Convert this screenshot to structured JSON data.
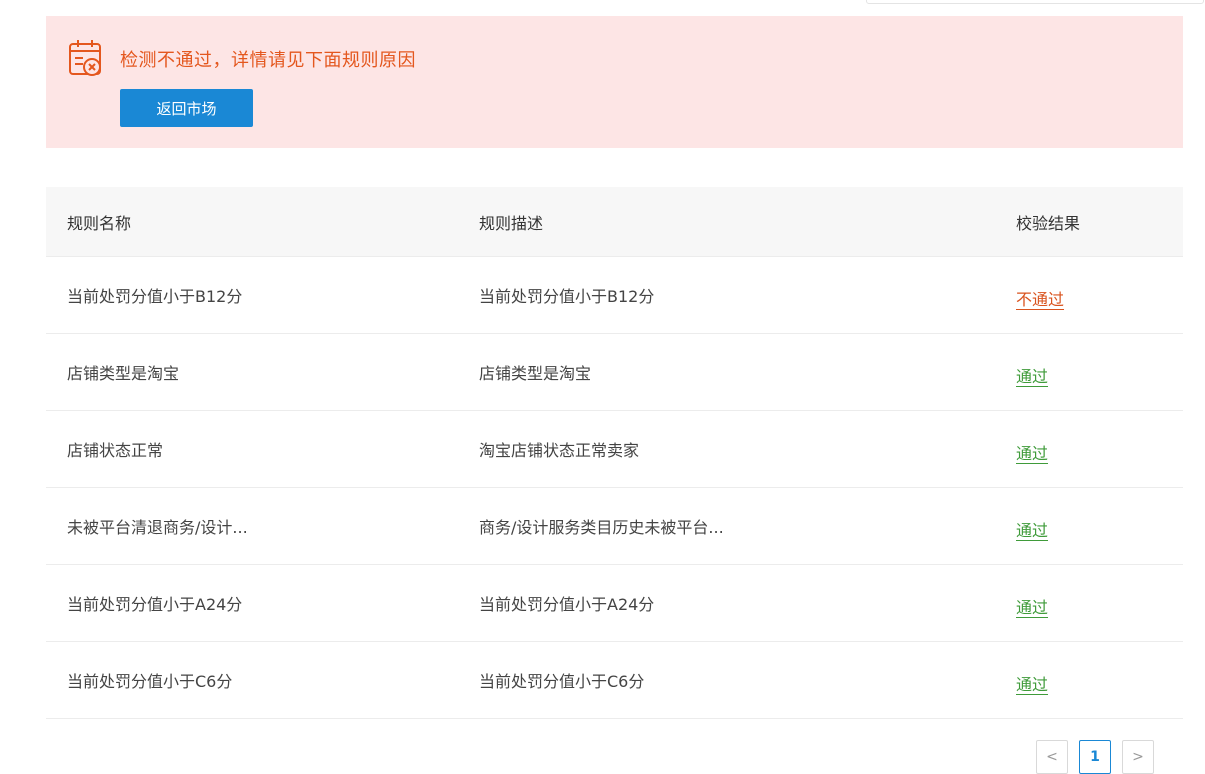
{
  "alert": {
    "title": "检测不通过，详情请见下面规则原因",
    "back_button_label": "返回市场",
    "icon": "calendar-x-icon",
    "color": "#e4571e",
    "background": "#fde5e5"
  },
  "table": {
    "headers": {
      "name": "规则名称",
      "description": "规则描述",
      "result": "校验结果"
    },
    "rows": [
      {
        "name": "当前处罚分值小于B12分",
        "description": "当前处罚分值小于B12分",
        "result": "不通过",
        "status": "fail"
      },
      {
        "name": "店铺类型是淘宝",
        "description": "店铺类型是淘宝",
        "result": "通过",
        "status": "pass"
      },
      {
        "name": "店铺状态正常",
        "description": "淘宝店铺状态正常卖家",
        "result": "通过",
        "status": "pass"
      },
      {
        "name": "未被平台清退商务/设计...",
        "description": "商务/设计服务类目历史未被平台...",
        "result": "通过",
        "status": "pass"
      },
      {
        "name": "当前处罚分值小于A24分",
        "description": "当前处罚分值小于A24分",
        "result": "通过",
        "status": "pass"
      },
      {
        "name": "当前处罚分值小于C6分",
        "description": "当前处罚分值小于C6分",
        "result": "通过",
        "status": "pass"
      }
    ]
  },
  "pagination": {
    "prev": "<",
    "current_page": "1",
    "next": ">"
  },
  "colors": {
    "pass": "#3f9b3a",
    "fail": "#d9531e",
    "primary": "#1a88d5"
  }
}
